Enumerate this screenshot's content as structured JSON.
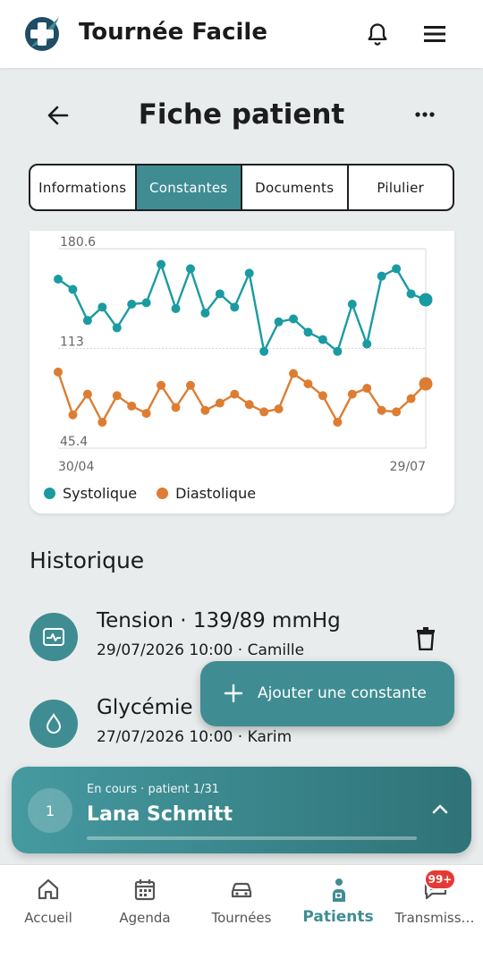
{
  "app": {
    "title": "Tournée Facile"
  },
  "page": {
    "title": "Fiche patient"
  },
  "tabs": [
    {
      "label": "Informations",
      "active": false
    },
    {
      "label": "Constantes",
      "active": true
    },
    {
      "label": "Documents",
      "active": false
    },
    {
      "label": "Pilulier",
      "active": false
    }
  ],
  "colors": {
    "accent": "#3f8d93",
    "systolic": "#1a9ba1",
    "diastolic": "#dd7d33"
  },
  "chart_data": {
    "type": "line",
    "y_ticks": [
      "180.6",
      "113",
      "45.4"
    ],
    "x_ticks": [
      "30/04",
      "29/07"
    ],
    "ylim": [
      45.4,
      180.6
    ],
    "series": [
      {
        "name": "Systolique",
        "values": [
          160,
          153,
          132,
          141,
          127,
          143,
          144,
          170,
          140,
          167,
          137,
          150,
          141,
          164,
          111,
          131,
          133,
          124,
          119,
          111,
          143,
          116,
          162,
          167,
          150,
          146
        ]
      },
      {
        "name": "Diastolique",
        "values": [
          97,
          68,
          82,
          63,
          81,
          74,
          69,
          88,
          73,
          88,
          71,
          76,
          82,
          75,
          70,
          72,
          96,
          89,
          81,
          63,
          82,
          86,
          71,
          70,
          79,
          89
        ]
      }
    ],
    "legend_position": "bottom-left",
    "grid": true
  },
  "history": {
    "title": "Historique",
    "items": [
      {
        "title": "Tension · 139/89 mmHg",
        "subtitle": "29/07/2026 10:00 · Camille",
        "icon": "heart-monitor-icon"
      },
      {
        "title": "Glycémie · ",
        "subtitle": "27/07/2026 10:00 · Karim",
        "icon": "drop-icon"
      }
    ]
  },
  "fab": {
    "label": "Ajouter une constante"
  },
  "current": {
    "number": "1",
    "status": "En cours · patient 1/31",
    "name": "Lana Schmitt"
  },
  "nav": [
    {
      "label": "Accueil",
      "icon": "home-icon"
    },
    {
      "label": "Agenda",
      "icon": "calendar-icon"
    },
    {
      "label": "Tournées",
      "icon": "car-icon"
    },
    {
      "label": "Patients",
      "icon": "patient-icon",
      "active": true
    },
    {
      "label": "Transmiss…",
      "icon": "chat-icon",
      "badge": "99+"
    }
  ]
}
